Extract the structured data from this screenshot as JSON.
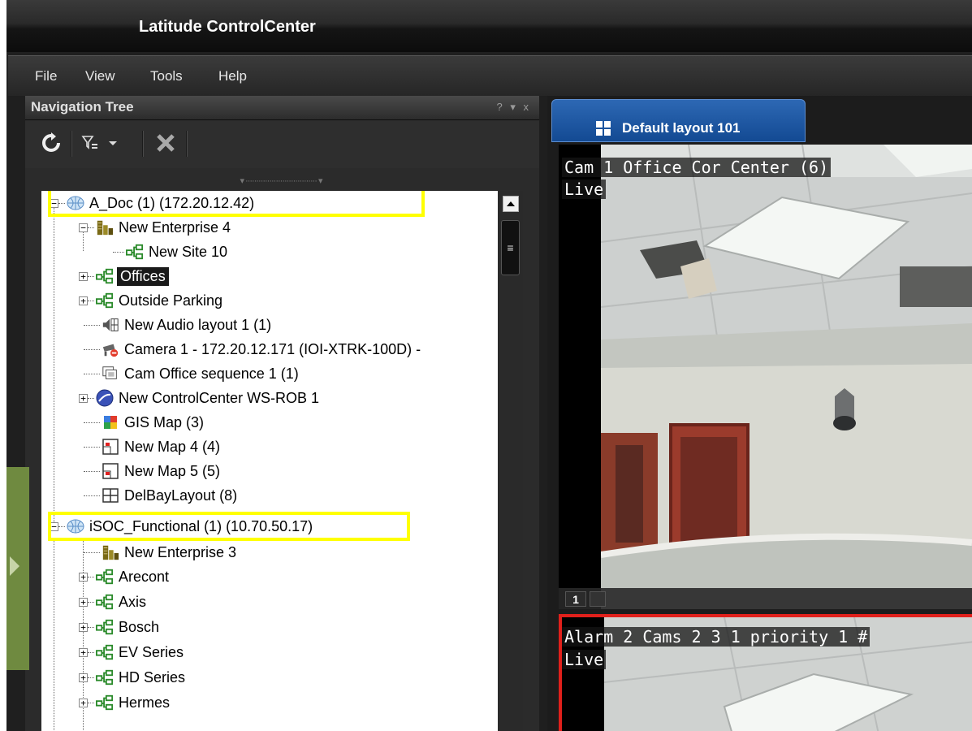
{
  "window": {
    "title": "Latitude ControlCenter"
  },
  "menu": [
    "File",
    "View",
    "Tools",
    "Help"
  ],
  "nav_panel": {
    "title": "Navigation Tree",
    "controls": "? ▾ x"
  },
  "tree": {
    "items": [
      {
        "label": "A_Doc (1) (172.20.12.42)",
        "icon": "server-globe-icon"
      },
      {
        "label": "New Enterprise 4",
        "icon": "enterprise-icon"
      },
      {
        "label": "New Site 10",
        "icon": "site-icon"
      },
      {
        "label": "Offices",
        "icon": "site-icon"
      },
      {
        "label": "Outside Parking",
        "icon": "site-icon"
      },
      {
        "label": "New Audio layout 1 (1)",
        "icon": "audio-layout-icon"
      },
      {
        "label": "Camera 1 - 172.20.12.171 (IOI-XTRK-100D) -",
        "icon": "camera-offline-icon"
      },
      {
        "label": "Cam Office sequence 1 (1)",
        "icon": "sequence-icon"
      },
      {
        "label": "New ControlCenter WS-ROB 1",
        "icon": "workstation-icon"
      },
      {
        "label": "GIS Map (3)",
        "icon": "gis-map-icon"
      },
      {
        "label": "New Map 4 (4)",
        "icon": "map-icon"
      },
      {
        "label": "New Map 5 (5)",
        "icon": "map-icon"
      },
      {
        "label": "DelBayLayout (8)",
        "icon": "layout-icon"
      },
      {
        "label": "iSOC_Functional (1) (10.70.50.17)",
        "icon": "server-globe-icon"
      },
      {
        "label": "New Enterprise 3",
        "icon": "enterprise-icon"
      },
      {
        "label": "Arecont",
        "icon": "site-icon"
      },
      {
        "label": "Axis",
        "icon": "site-icon"
      },
      {
        "label": "Bosch",
        "icon": "site-icon"
      },
      {
        "label": "EV Series",
        "icon": "site-icon"
      },
      {
        "label": "HD Series",
        "icon": "site-icon"
      },
      {
        "label": "Hermes",
        "icon": "site-icon"
      }
    ]
  },
  "layout_tab": {
    "label": "Default layout 101"
  },
  "tiles": [
    {
      "camera": "Cam 1 Office Cor Center (6)",
      "mode": "Live",
      "number": "1"
    },
    {
      "camera": "Alarm 2 Cams 2 3 1 priority 1 #",
      "mode": "Live"
    }
  ],
  "colors": {
    "highlight": "#ffff00",
    "tab_blue": "#1f5aa6",
    "alarm_border": "#e0201b",
    "selected_bg": "#1a1a1a"
  }
}
